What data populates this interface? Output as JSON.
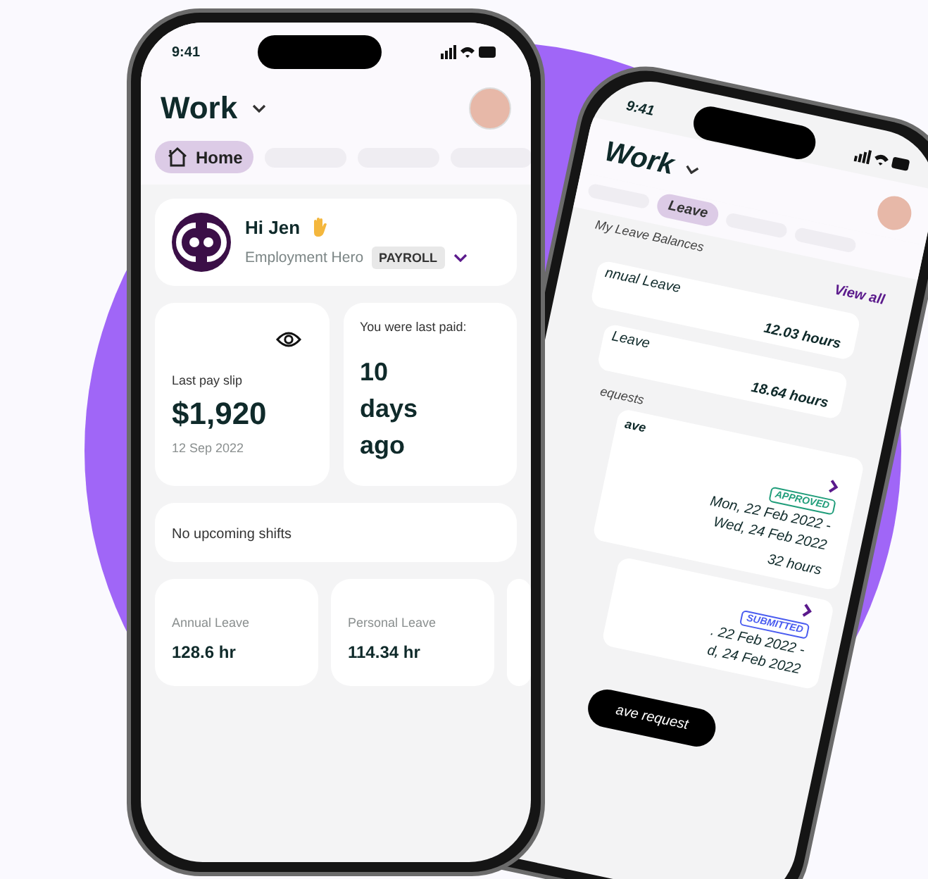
{
  "front_phone": {
    "status_bar": {
      "time": "9:41"
    },
    "header": {
      "title": "Work"
    },
    "tabs": [
      {
        "label": "Home",
        "selected": true
      }
    ],
    "greeting": {
      "text": "Hi Jen",
      "company": "Employment Hero",
      "badge": "PAYROLL"
    },
    "pay_slip": {
      "label": "Last pay slip",
      "amount": "$1,920",
      "date": "12 Sep 2022"
    },
    "last_paid": {
      "label": "You were last paid:",
      "value": "10 days ago"
    },
    "shifts": {
      "text": "No upcoming shifts"
    },
    "leave_balances": [
      {
        "name": "Annual Leave",
        "value": "128.6 hr"
      },
      {
        "name": "Personal Leave",
        "value": "114.34 hr"
      }
    ]
  },
  "back_phone": {
    "status_bar": {
      "time": "9:41"
    },
    "header": {
      "title": "Work"
    },
    "tabs": [
      {
        "label": "Leave",
        "selected": true
      }
    ],
    "balances_heading": "My Leave Balances",
    "view_all": "View all",
    "balances": [
      {
        "name": "nnual Leave",
        "value": "12.03 hours"
      },
      {
        "name": "Leave",
        "value": "18.64 hours"
      }
    ],
    "requests_heading": "equests",
    "requests": [
      {
        "title": "ave",
        "status": "APPROVED",
        "kind": "approved",
        "dates": [
          "Mon, 22 Feb 2022 -",
          "Wed, 24 Feb 2022"
        ],
        "hours": "32 hours"
      },
      {
        "status": "SUBMITTED",
        "kind": "submitted",
        "dates": [
          ". 22 Feb 2022 -",
          "d, 24 Feb 2022"
        ]
      }
    ],
    "button": "ave request"
  }
}
